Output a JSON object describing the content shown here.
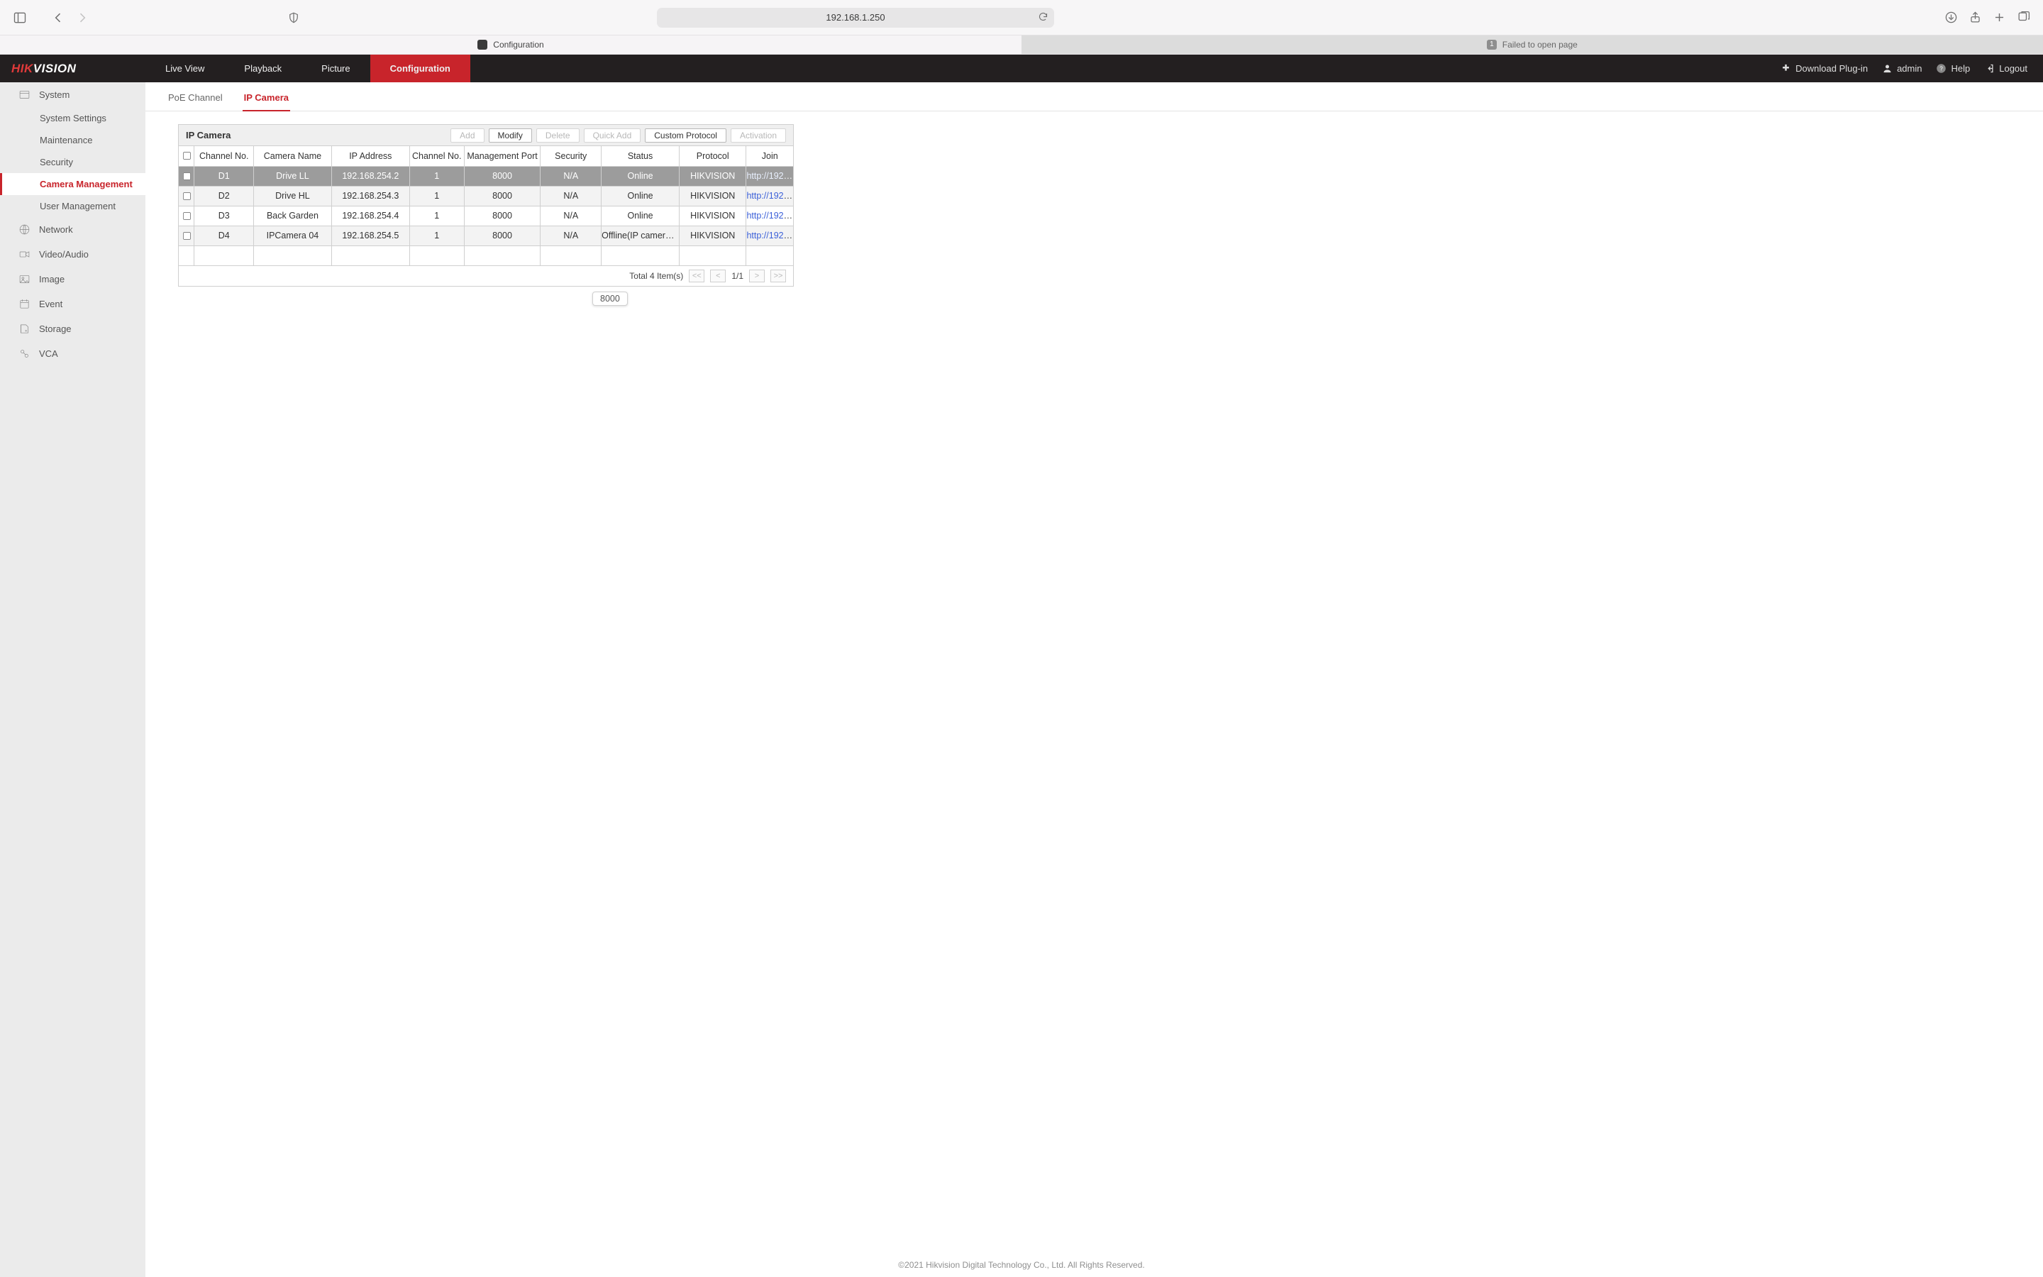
{
  "browser": {
    "address": "192.168.1.250",
    "tabs": [
      {
        "label": "Configuration",
        "selected": true
      },
      {
        "label": "Failed to open page",
        "selected": false,
        "badge": "1"
      }
    ]
  },
  "brand": {
    "part1": "HIK",
    "part2": "VISION"
  },
  "topnav": {
    "items": [
      {
        "key": "liveview",
        "label": "Live View"
      },
      {
        "key": "playback",
        "label": "Playback"
      },
      {
        "key": "picture",
        "label": "Picture"
      },
      {
        "key": "configuration",
        "label": "Configuration",
        "active": true
      }
    ],
    "right": {
      "download": "Download Plug-in",
      "user": "admin",
      "help": "Help",
      "logout": "Logout"
    }
  },
  "sidebar": {
    "system": "System",
    "system_children": [
      {
        "key": "system_settings",
        "label": "System Settings"
      },
      {
        "key": "maintenance",
        "label": "Maintenance"
      },
      {
        "key": "security",
        "label": "Security"
      },
      {
        "key": "camera_management",
        "label": "Camera Management",
        "selected": true
      },
      {
        "key": "user_management",
        "label": "User Management"
      }
    ],
    "network": "Network",
    "video_audio": "Video/Audio",
    "image": "Image",
    "event": "Event",
    "storage": "Storage",
    "vca": "VCA"
  },
  "subtabs": {
    "poe": "PoE Channel",
    "ipcam": "IP Camera"
  },
  "panel": {
    "title": "IP Camera",
    "buttons": {
      "add": "Add",
      "modify": "Modify",
      "delete": "Delete",
      "quick_add": "Quick Add",
      "custom_protocol": "Custom Protocol",
      "activation": "Activation"
    },
    "columns": [
      "Channel No.",
      "Camera Name",
      "IP Address",
      "Channel No.",
      "Management Port",
      "Security",
      "Status",
      "Protocol",
      "Join"
    ],
    "rows": [
      {
        "ch": "D1",
        "name": "Drive LL",
        "ip": "192.168.254.2",
        "ch2": "1",
        "port": "8000",
        "sec": "N/A",
        "status": "Online",
        "proto": "HIKVISION",
        "join": "http://192.16…",
        "selected": true
      },
      {
        "ch": "D2",
        "name": "Drive HL",
        "ip": "192.168.254.3",
        "ch2": "1",
        "port": "8000",
        "sec": "N/A",
        "status": "Online",
        "proto": "HIKVISION",
        "join": "http://192.16…"
      },
      {
        "ch": "D3",
        "name": "Back Garden",
        "ip": "192.168.254.4",
        "ch2": "1",
        "port": "8000",
        "sec": "N/A",
        "status": "Online",
        "proto": "HIKVISION",
        "join": "http://192.16…"
      },
      {
        "ch": "D4",
        "name": "IPCamera 04",
        "ip": "192.168.254.5",
        "ch2": "1",
        "port": "8000",
        "sec": "N/A",
        "status": "Offline(IP camera…",
        "proto": "HIKVISION",
        "join": "http://192.16…"
      }
    ],
    "tooltip": "8000",
    "footer": {
      "total": "Total 4 Item(s)",
      "page": "1/1",
      "first": "<<",
      "prev": "<",
      "next": ">",
      "last": ">>"
    }
  },
  "copyright": "©2021 Hikvision Digital Technology Co., Ltd. All Rights Reserved."
}
